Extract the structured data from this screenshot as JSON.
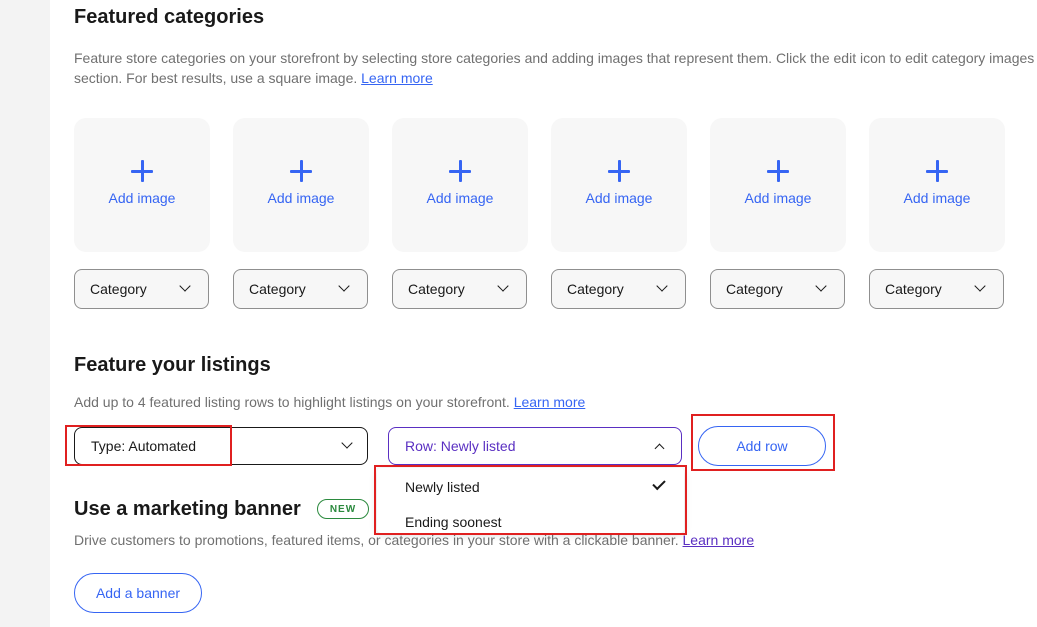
{
  "featured_categories": {
    "title": "Featured categories",
    "description": "Feature store categories on your storefront by selecting store categories and adding images that represent them. Click the edit icon to edit category images section. For best results, use a square image.",
    "learn_more": "Learn more",
    "tiles": [
      {
        "add_label": "Add image",
        "category_label": "Category"
      },
      {
        "add_label": "Add image",
        "category_label": "Category"
      },
      {
        "add_label": "Add image",
        "category_label": "Category"
      },
      {
        "add_label": "Add image",
        "category_label": "Category"
      },
      {
        "add_label": "Add image",
        "category_label": "Category"
      },
      {
        "add_label": "Add image",
        "category_label": "Category"
      }
    ]
  },
  "feature_listings": {
    "title": "Feature your listings",
    "description": "Add up to 4 featured listing rows to highlight listings on your storefront.",
    "learn_more": "Learn more",
    "type_select": "Type: Automated",
    "row_select": "Row: Newly listed",
    "add_row": "Add row",
    "row_options": [
      {
        "label": "Newly listed",
        "selected": true
      },
      {
        "label": "Ending soonest",
        "selected": false
      }
    ]
  },
  "marketing_banner": {
    "title": "Use a marketing banner",
    "badge": "NEW",
    "description_start": "Drive customers to promotions, featured items, o",
    "description_end": "r categories in your store with a clickable banner.",
    "learn_more": "Learn more",
    "add_banner": "Add a banner"
  },
  "colors": {
    "accent": "#3665f3",
    "visited": "#5a2fc2",
    "highlight": "#e02020",
    "badge_green": "#2b8a3e"
  }
}
